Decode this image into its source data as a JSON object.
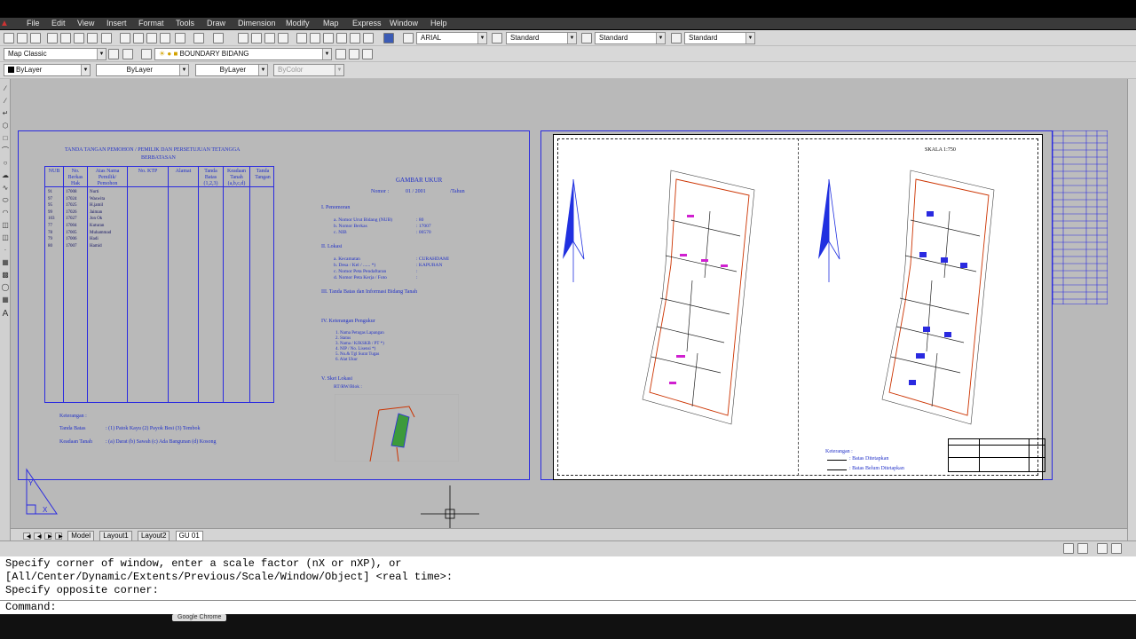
{
  "menu": [
    "File",
    "Edit",
    "View",
    "Insert",
    "Format",
    "Tools",
    "Draw",
    "Dimension",
    "Modify",
    "Map",
    "Express",
    "Window",
    "Help"
  ],
  "toolbar1": {
    "font": "ARIAL",
    "textstyle": "Standard",
    "dimstyle": "Standard",
    "mleaderstyle": "Standard"
  },
  "toolbar2": {
    "workspace": "Map Classic",
    "layer": "BOUNDARY BIDANG"
  },
  "toolbar3": {
    "color": "ByLayer",
    "linetype": "ByLayer",
    "lineweight": "ByLayer",
    "plotstyle": "ByColor"
  },
  "tabs": [
    "Model",
    "Layout1",
    "Layout2",
    "GU 01"
  ],
  "form": {
    "title_line1": "TANDA TANGAN PEMOHON / PEMILIK DAN PERSETUJUAN TETANGGA",
    "title_line2": "BERBATASAN",
    "headers": [
      "NUB",
      "No. Berkas Hak",
      "Atas Nama Pemilik/ Pemohon",
      "No. KTP",
      "Alamat",
      "Tanda Batas (1,2,3)",
      "Keadaan Tanah (a,b,c,d)",
      "Tanda Tangan"
    ],
    "rows": [
      [
        "91",
        "17008",
        "Nurti"
      ],
      [
        "97",
        "17024",
        "Waswita"
      ],
      [
        "95",
        "17025",
        "H.jamil"
      ],
      [
        "99",
        "17026",
        "Jaiman"
      ],
      [
        "103",
        "17027",
        "Jon Ok"
      ],
      [
        "77",
        "17004",
        "Kuturan"
      ],
      [
        "78",
        "17005",
        "Muhammad"
      ],
      [
        "79",
        "17006",
        "Hadi"
      ],
      [
        "80",
        "17007",
        "Hamid"
      ]
    ],
    "keterangan": "Keterangan :",
    "tanda_batas_label": "Tanda Batas",
    "tanda_batas_vals": ": (1) Patok Kayu  (2) Payok Besi   (3) Tembok",
    "keadaan_label": "Keadaan Tanah",
    "keadaan_vals": ": (a) Darat          (b) Sawah         (c) Ada Bangunan    (d) Kosong"
  },
  "gambar_ukur": {
    "title": "GAMBAR UKUR",
    "nomor_label": "Nomor :",
    "nomor": "01 / 2001",
    "tahun": "/Tahun",
    "s1": "I.    Penomoran",
    "s1_items": [
      "a. Nomor Urut Bidang (NUB)",
      "b. Nomor Berkas",
      "c. NIB"
    ],
    "s1_vals": [
      ": 80",
      ": 17007",
      ": 00570"
    ],
    "s2": "II.   Lokasi",
    "s2_items": [
      "a. Kecamatan",
      "b. Desa / Kel / ...... *)",
      "c. Nomor Peta Pendaftaran",
      "d. Nomor Peta Kerja / Foto"
    ],
    "s2_vals": [
      ": CURAHDAMI",
      ": KAPURAN",
      ":",
      ":"
    ],
    "s3": "III.  Tanda Batas dan Informasi Bidang Tanah",
    "s4": "IV.   Keterangan Pengukur",
    "s4_items": [
      "1. Nama Petugas Lapangan",
      "2. Status",
      "3. Nama / KJKSKB / PT *)",
      "4. NIP / No. Lisensi *)",
      "5. No.& Tgl Surat Tugas",
      "6. Alat Ukur"
    ],
    "s5": "V.    Sket Lokasi",
    "s5_sub": "RT/RW/Blok    :"
  },
  "layout2": {
    "skala": "SKALA 1:750",
    "keterangan": "Keterangan :",
    "legend1": ": Batas Ditetapkan",
    "legend2": ": Batas Belum Ditetapkan"
  },
  "command": {
    "line1": "Specify corner of window, enter a scale factor (nX or nXP), or",
    "line2": "[All/Center/Dynamic/Extents/Previous/Scale/Window/Object] <real time>:",
    "line3": "Specify opposite corner:",
    "prompt": "Command:"
  },
  "taskbar": {
    "item": "Google Chrome"
  },
  "colors": {
    "drawing_blue": "#2a2ae0",
    "parcel_red": "#cc3300",
    "magenta": "#d020d0",
    "canvas": "#b9b9b9"
  }
}
